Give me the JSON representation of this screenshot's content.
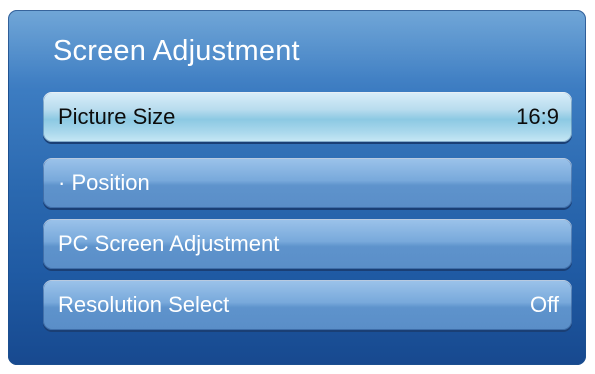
{
  "panel": {
    "title": "Screen Adjustment"
  },
  "menu": {
    "items": [
      {
        "label": "Picture Size",
        "value": "16:9",
        "selected": true
      },
      {
        "label": "· Position",
        "value": "",
        "selected": false
      },
      {
        "label": "PC Screen Adjustment",
        "value": "",
        "selected": false
      },
      {
        "label": "Resolution Select",
        "value": "Off",
        "selected": false
      }
    ]
  },
  "colors": {
    "panel_top": "#5d9ad2",
    "panel_bottom": "#17498f",
    "item_normal": "#78a9db",
    "item_selected": "#b8dcee",
    "text_normal": "#ffffff",
    "text_selected": "#0c0c0c"
  }
}
